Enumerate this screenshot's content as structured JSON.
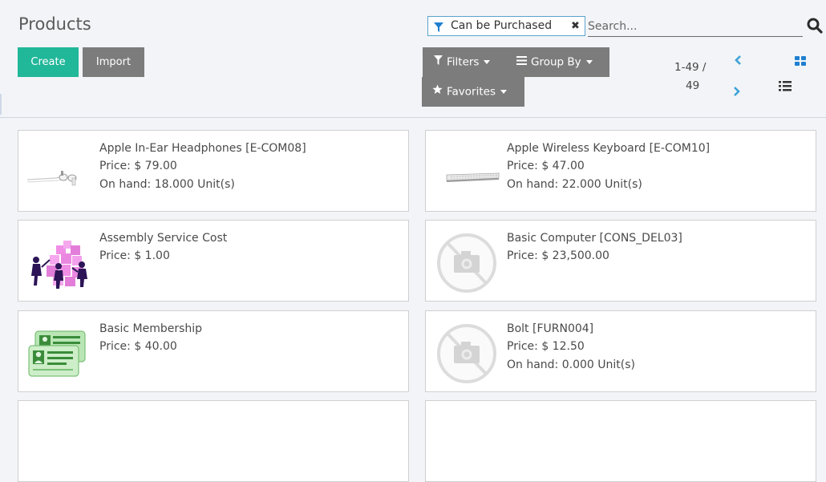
{
  "page": {
    "title": "Products"
  },
  "buttons": {
    "create": "Create",
    "import": "Import"
  },
  "search": {
    "facet_label": "Can be Purchased",
    "placeholder": "Search...",
    "facet_icon": "funnel-icon",
    "remove_icon": "close-icon",
    "search_icon": "magnifier-icon"
  },
  "filters": {
    "filters": "Filters",
    "group_by": "Group By",
    "favorites": "Favorites"
  },
  "pager": {
    "range": "1-49 /",
    "total": "49"
  },
  "colors": {
    "primary": "#21b799",
    "secondary": "#7c7c7c",
    "link": "#3ea2d8",
    "facet_border": "#5aa4cf"
  },
  "products": [
    {
      "name": "Apple In-Ear Headphones [E-COM08]",
      "price": "Price: $ 79.00",
      "on_hand": "On hand: 18.000 Unit(s)",
      "image": "headphones"
    },
    {
      "name": "Apple Wireless Keyboard [E-COM10]",
      "price": "Price: $ 47.00",
      "on_hand": "On hand: 22.000 Unit(s)",
      "image": "keyboard"
    },
    {
      "name": "Assembly Service Cost",
      "price": "Price: $ 1.00",
      "on_hand": "",
      "image": "assembly-workers"
    },
    {
      "name": "Basic Computer [CONS_DEL03]",
      "price": "Price: $ 23,500.00",
      "on_hand": "",
      "image": "no-image-placeholder"
    },
    {
      "name": "Basic Membership",
      "price": "Price: $ 40.00",
      "on_hand": "",
      "image": "membership-cards"
    },
    {
      "name": "Bolt [FURN004]",
      "price": "Price: $ 12.50",
      "on_hand": "On hand: 0.000 Unit(s)",
      "image": "no-image-placeholder"
    }
  ]
}
